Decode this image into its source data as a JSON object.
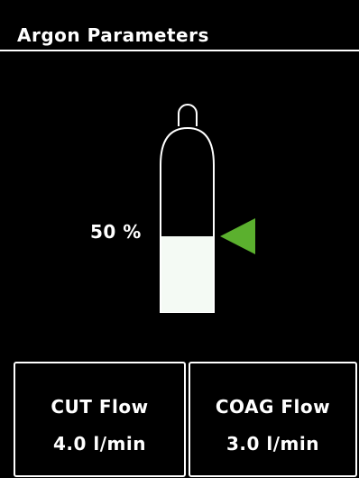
{
  "header": {
    "title": "Argon Parameters"
  },
  "gauge": {
    "level_percent": 50,
    "level_text": "50 %",
    "fill_color": "#f4faf4",
    "outline_color": "#ffffff",
    "indicator_color": "#5bb02e"
  },
  "flows": {
    "cut": {
      "label": "CUT Flow",
      "value": "4.0 l/min"
    },
    "coag": {
      "label": "COAG Flow",
      "value": "3.0 l/min"
    }
  }
}
